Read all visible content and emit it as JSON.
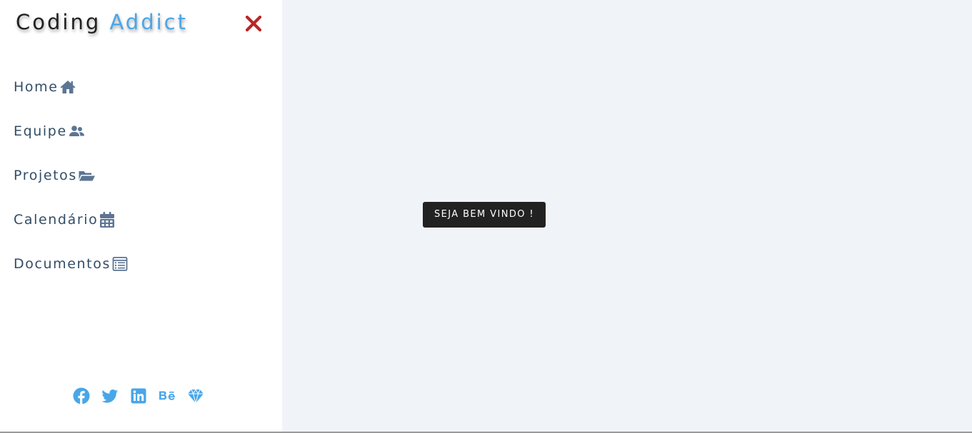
{
  "logo": {
    "primary": "Coding",
    "accent": "Addict"
  },
  "colors": {
    "accent": "#49a6e9",
    "nav_text": "#324d67",
    "close": "#bb2525",
    "main_bg": "#f0f4f8",
    "tooltip_bg": "#222222"
  },
  "sidebar": {
    "close_icon": "close-icon",
    "items": [
      {
        "label": "Home",
        "icon": "home-icon"
      },
      {
        "label": "Equipe",
        "icon": "users-icon"
      },
      {
        "label": "Projetos",
        "icon": "folder-open-icon"
      },
      {
        "label": "Calendário",
        "icon": "calendar-icon"
      },
      {
        "label": "Documentos",
        "icon": "document-list-icon"
      }
    ],
    "socials": [
      {
        "icon": "facebook-icon"
      },
      {
        "icon": "twitter-icon"
      },
      {
        "icon": "linkedin-icon"
      },
      {
        "icon": "behance-icon"
      },
      {
        "icon": "sketch-icon"
      }
    ]
  },
  "main": {
    "tooltip": "SEJA BEM VINDO !"
  }
}
